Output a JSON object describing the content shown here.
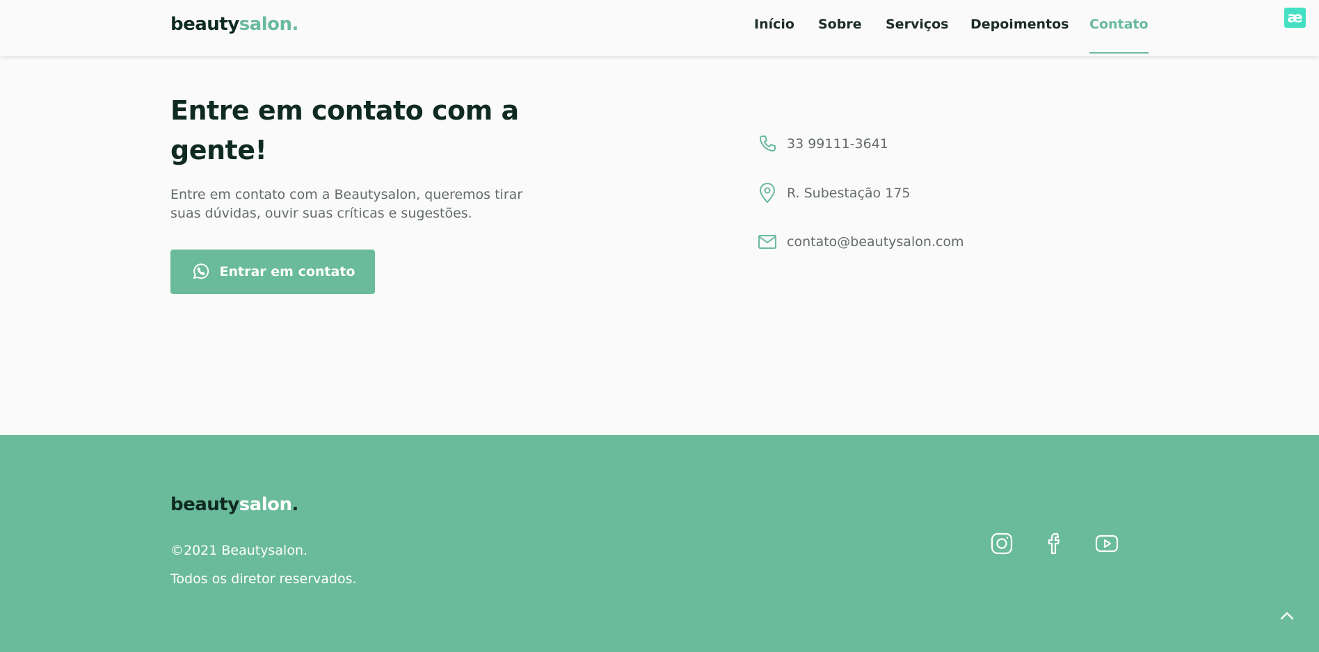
{
  "brand": {
    "part1": "beauty",
    "part2": "salon",
    "dot": "."
  },
  "nav": {
    "items": [
      {
        "label": "Início"
      },
      {
        "label": "Sobre"
      },
      {
        "label": "Serviços"
      },
      {
        "label": "Depoimentos"
      },
      {
        "label": "Contato",
        "active": true
      }
    ]
  },
  "badge": {
    "label": "æ"
  },
  "contact": {
    "title": "Entre em contato com a gente!",
    "description": "Entre em contato com a Beautysalon, queremos tirar suas dúvidas, ouvir suas críticas e sugestões.",
    "button_label": "Entrar em contato",
    "button_icon": "whatsapp-icon",
    "info": [
      {
        "icon": "phone-icon",
        "text": "33 99111-3641"
      },
      {
        "icon": "location-pin-icon",
        "text": "R. Subestação 175"
      },
      {
        "icon": "mail-icon",
        "text": "contato@beautysalon.com"
      }
    ]
  },
  "footer": {
    "copyright": "©2021 Beautysalon.",
    "rights": "Todos os diretor reservados.",
    "social": [
      "instagram-icon",
      "facebook-icon",
      "youtube-icon"
    ]
  },
  "colors": {
    "accent": "#6aba9c",
    "dark": "#0f2a22",
    "muted_text": "#646c69",
    "background": "#fafafa",
    "badge": "#45e0c4"
  }
}
